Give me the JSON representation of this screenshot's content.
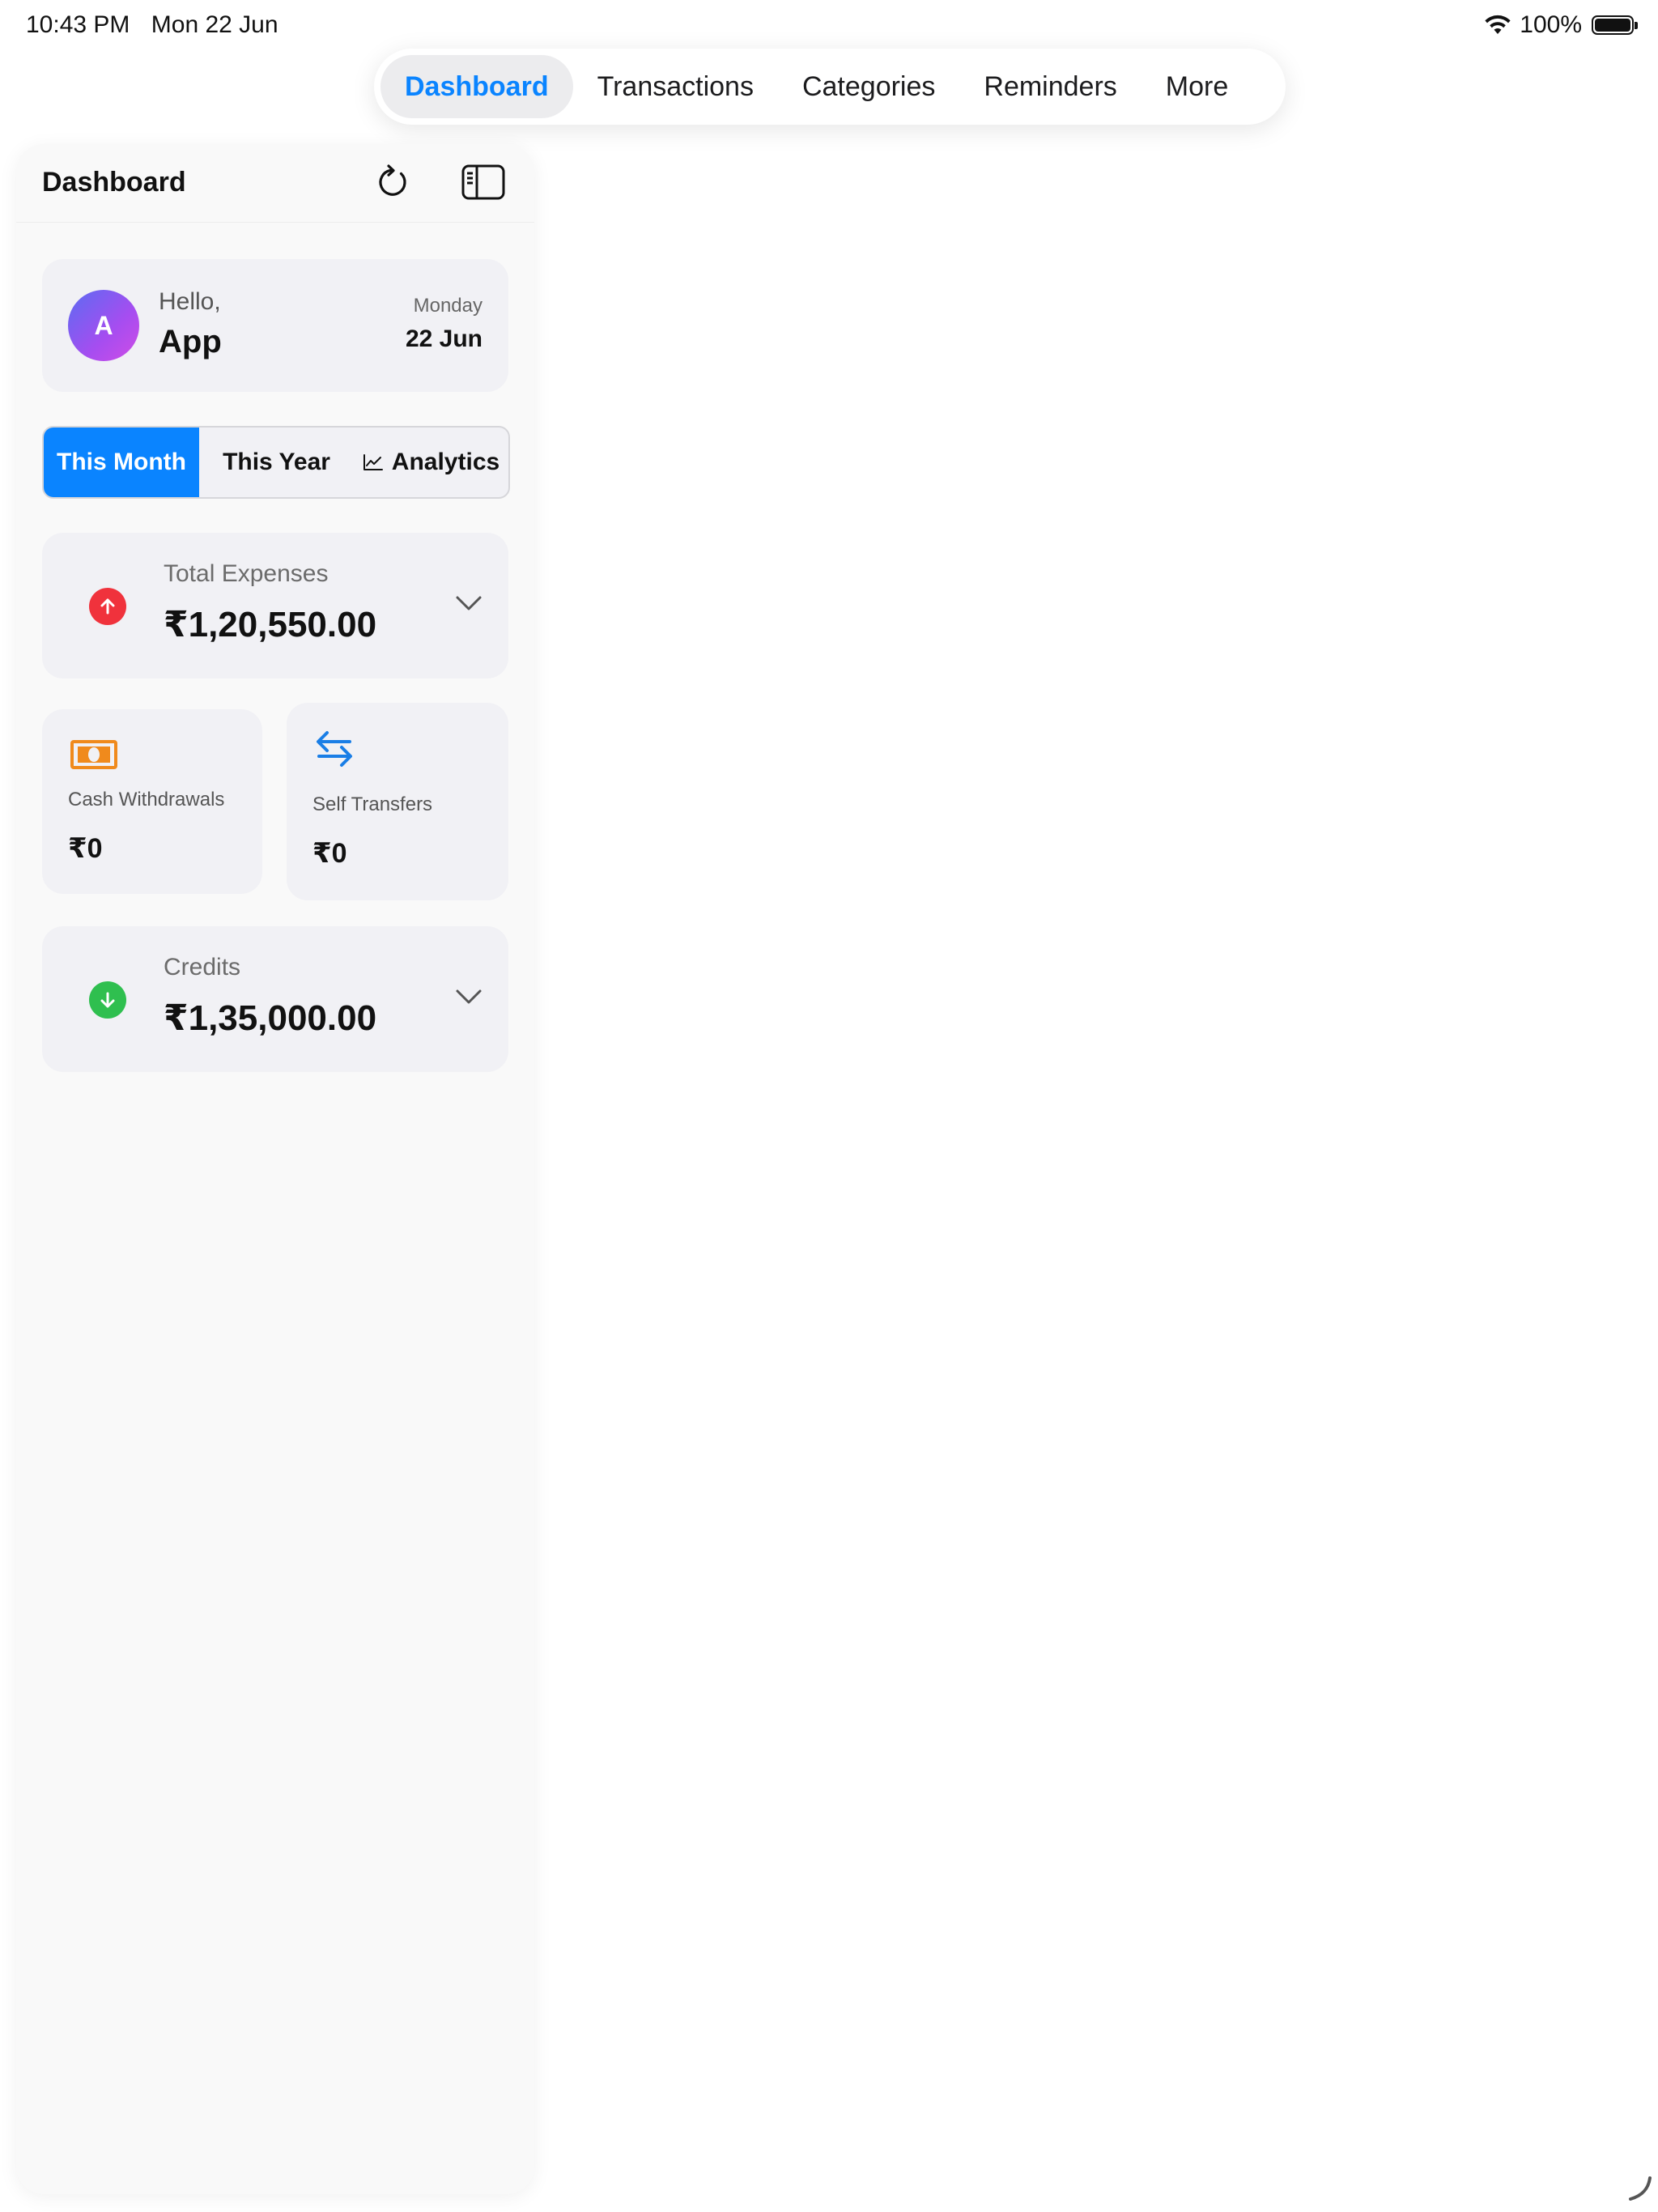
{
  "status_bar": {
    "time": "10:43 PM",
    "date": "Mon 22 Jun",
    "battery_percent": "100%",
    "icons": [
      "wifi-icon",
      "battery-icon"
    ]
  },
  "top_tabs": {
    "items": [
      {
        "label": "Dashboard",
        "active": true
      },
      {
        "label": "Transactions",
        "active": false
      },
      {
        "label": "Categories",
        "active": false
      },
      {
        "label": "Reminders",
        "active": false
      },
      {
        "label": "More",
        "active": false
      }
    ]
  },
  "sidebar": {
    "title": "Dashboard",
    "icons": [
      "refresh-icon",
      "sidebar-toggle-icon"
    ],
    "greeting": {
      "avatar_initial": "A",
      "hello": "Hello,",
      "name": "App",
      "weekday": "Monday",
      "date": "22 Jun"
    },
    "period_selector": {
      "options": [
        "This Month",
        "This Year",
        "Analytics"
      ],
      "selected": "This Month"
    },
    "total_expenses": {
      "label": "Total Expenses",
      "value": "₹1,20,550.00",
      "icon": "arrow-up-icon",
      "icon_color": "#f0323c"
    },
    "cash_withdrawals": {
      "label": "Cash Withdrawals",
      "value": "₹0",
      "icon": "banknote-icon",
      "icon_color": "#f08a1c"
    },
    "self_transfers": {
      "label": "Self Transfers",
      "value": "₹0",
      "icon": "transfer-arrows-icon",
      "icon_color": "#1a7ee6"
    },
    "credits": {
      "label": "Credits",
      "value": "₹1,35,000.00",
      "icon": "arrow-down-icon",
      "icon_color": "#2fbf4f"
    }
  },
  "colors": {
    "accent": "#0a84ff",
    "card_background": "#f1f1f5",
    "panel_background": "#f9f9f9"
  }
}
